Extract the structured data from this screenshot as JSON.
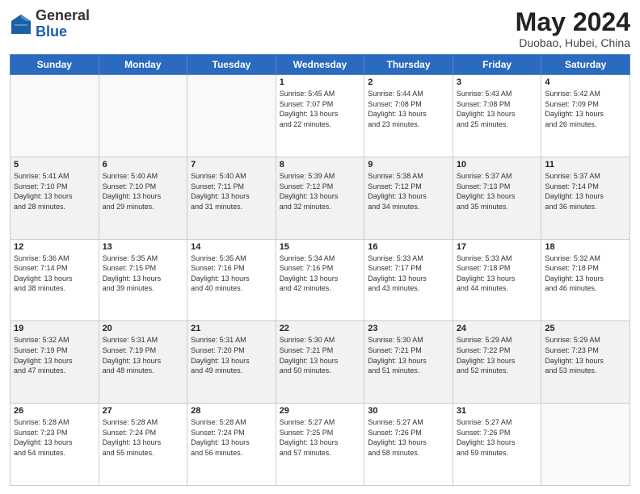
{
  "header": {
    "logo_general": "General",
    "logo_blue": "Blue",
    "month_year": "May 2024",
    "location": "Duobao, Hubei, China"
  },
  "days_of_week": [
    "Sunday",
    "Monday",
    "Tuesday",
    "Wednesday",
    "Thursday",
    "Friday",
    "Saturday"
  ],
  "weeks": [
    {
      "shade": false,
      "days": [
        {
          "num": "",
          "info": ""
        },
        {
          "num": "",
          "info": ""
        },
        {
          "num": "",
          "info": ""
        },
        {
          "num": "1",
          "info": "Sunrise: 5:45 AM\nSunset: 7:07 PM\nDaylight: 13 hours\nand 22 minutes."
        },
        {
          "num": "2",
          "info": "Sunrise: 5:44 AM\nSunset: 7:08 PM\nDaylight: 13 hours\nand 23 minutes."
        },
        {
          "num": "3",
          "info": "Sunrise: 5:43 AM\nSunset: 7:08 PM\nDaylight: 13 hours\nand 25 minutes."
        },
        {
          "num": "4",
          "info": "Sunrise: 5:42 AM\nSunset: 7:09 PM\nDaylight: 13 hours\nand 26 minutes."
        }
      ]
    },
    {
      "shade": true,
      "days": [
        {
          "num": "5",
          "info": "Sunrise: 5:41 AM\nSunset: 7:10 PM\nDaylight: 13 hours\nand 28 minutes."
        },
        {
          "num": "6",
          "info": "Sunrise: 5:40 AM\nSunset: 7:10 PM\nDaylight: 13 hours\nand 29 minutes."
        },
        {
          "num": "7",
          "info": "Sunrise: 5:40 AM\nSunset: 7:11 PM\nDaylight: 13 hours\nand 31 minutes."
        },
        {
          "num": "8",
          "info": "Sunrise: 5:39 AM\nSunset: 7:12 PM\nDaylight: 13 hours\nand 32 minutes."
        },
        {
          "num": "9",
          "info": "Sunrise: 5:38 AM\nSunset: 7:12 PM\nDaylight: 13 hours\nand 34 minutes."
        },
        {
          "num": "10",
          "info": "Sunrise: 5:37 AM\nSunset: 7:13 PM\nDaylight: 13 hours\nand 35 minutes."
        },
        {
          "num": "11",
          "info": "Sunrise: 5:37 AM\nSunset: 7:14 PM\nDaylight: 13 hours\nand 36 minutes."
        }
      ]
    },
    {
      "shade": false,
      "days": [
        {
          "num": "12",
          "info": "Sunrise: 5:36 AM\nSunset: 7:14 PM\nDaylight: 13 hours\nand 38 minutes."
        },
        {
          "num": "13",
          "info": "Sunrise: 5:35 AM\nSunset: 7:15 PM\nDaylight: 13 hours\nand 39 minutes."
        },
        {
          "num": "14",
          "info": "Sunrise: 5:35 AM\nSunset: 7:16 PM\nDaylight: 13 hours\nand 40 minutes."
        },
        {
          "num": "15",
          "info": "Sunrise: 5:34 AM\nSunset: 7:16 PM\nDaylight: 13 hours\nand 42 minutes."
        },
        {
          "num": "16",
          "info": "Sunrise: 5:33 AM\nSunset: 7:17 PM\nDaylight: 13 hours\nand 43 minutes."
        },
        {
          "num": "17",
          "info": "Sunrise: 5:33 AM\nSunset: 7:18 PM\nDaylight: 13 hours\nand 44 minutes."
        },
        {
          "num": "18",
          "info": "Sunrise: 5:32 AM\nSunset: 7:18 PM\nDaylight: 13 hours\nand 46 minutes."
        }
      ]
    },
    {
      "shade": true,
      "days": [
        {
          "num": "19",
          "info": "Sunrise: 5:32 AM\nSunset: 7:19 PM\nDaylight: 13 hours\nand 47 minutes."
        },
        {
          "num": "20",
          "info": "Sunrise: 5:31 AM\nSunset: 7:19 PM\nDaylight: 13 hours\nand 48 minutes."
        },
        {
          "num": "21",
          "info": "Sunrise: 5:31 AM\nSunset: 7:20 PM\nDaylight: 13 hours\nand 49 minutes."
        },
        {
          "num": "22",
          "info": "Sunrise: 5:30 AM\nSunset: 7:21 PM\nDaylight: 13 hours\nand 50 minutes."
        },
        {
          "num": "23",
          "info": "Sunrise: 5:30 AM\nSunset: 7:21 PM\nDaylight: 13 hours\nand 51 minutes."
        },
        {
          "num": "24",
          "info": "Sunrise: 5:29 AM\nSunset: 7:22 PM\nDaylight: 13 hours\nand 52 minutes."
        },
        {
          "num": "25",
          "info": "Sunrise: 5:29 AM\nSunset: 7:23 PM\nDaylight: 13 hours\nand 53 minutes."
        }
      ]
    },
    {
      "shade": false,
      "days": [
        {
          "num": "26",
          "info": "Sunrise: 5:28 AM\nSunset: 7:23 PM\nDaylight: 13 hours\nand 54 minutes."
        },
        {
          "num": "27",
          "info": "Sunrise: 5:28 AM\nSunset: 7:24 PM\nDaylight: 13 hours\nand 55 minutes."
        },
        {
          "num": "28",
          "info": "Sunrise: 5:28 AM\nSunset: 7:24 PM\nDaylight: 13 hours\nand 56 minutes."
        },
        {
          "num": "29",
          "info": "Sunrise: 5:27 AM\nSunset: 7:25 PM\nDaylight: 13 hours\nand 57 minutes."
        },
        {
          "num": "30",
          "info": "Sunrise: 5:27 AM\nSunset: 7:26 PM\nDaylight: 13 hours\nand 58 minutes."
        },
        {
          "num": "31",
          "info": "Sunrise: 5:27 AM\nSunset: 7:26 PM\nDaylight: 13 hours\nand 59 minutes."
        },
        {
          "num": "",
          "info": ""
        }
      ]
    }
  ]
}
